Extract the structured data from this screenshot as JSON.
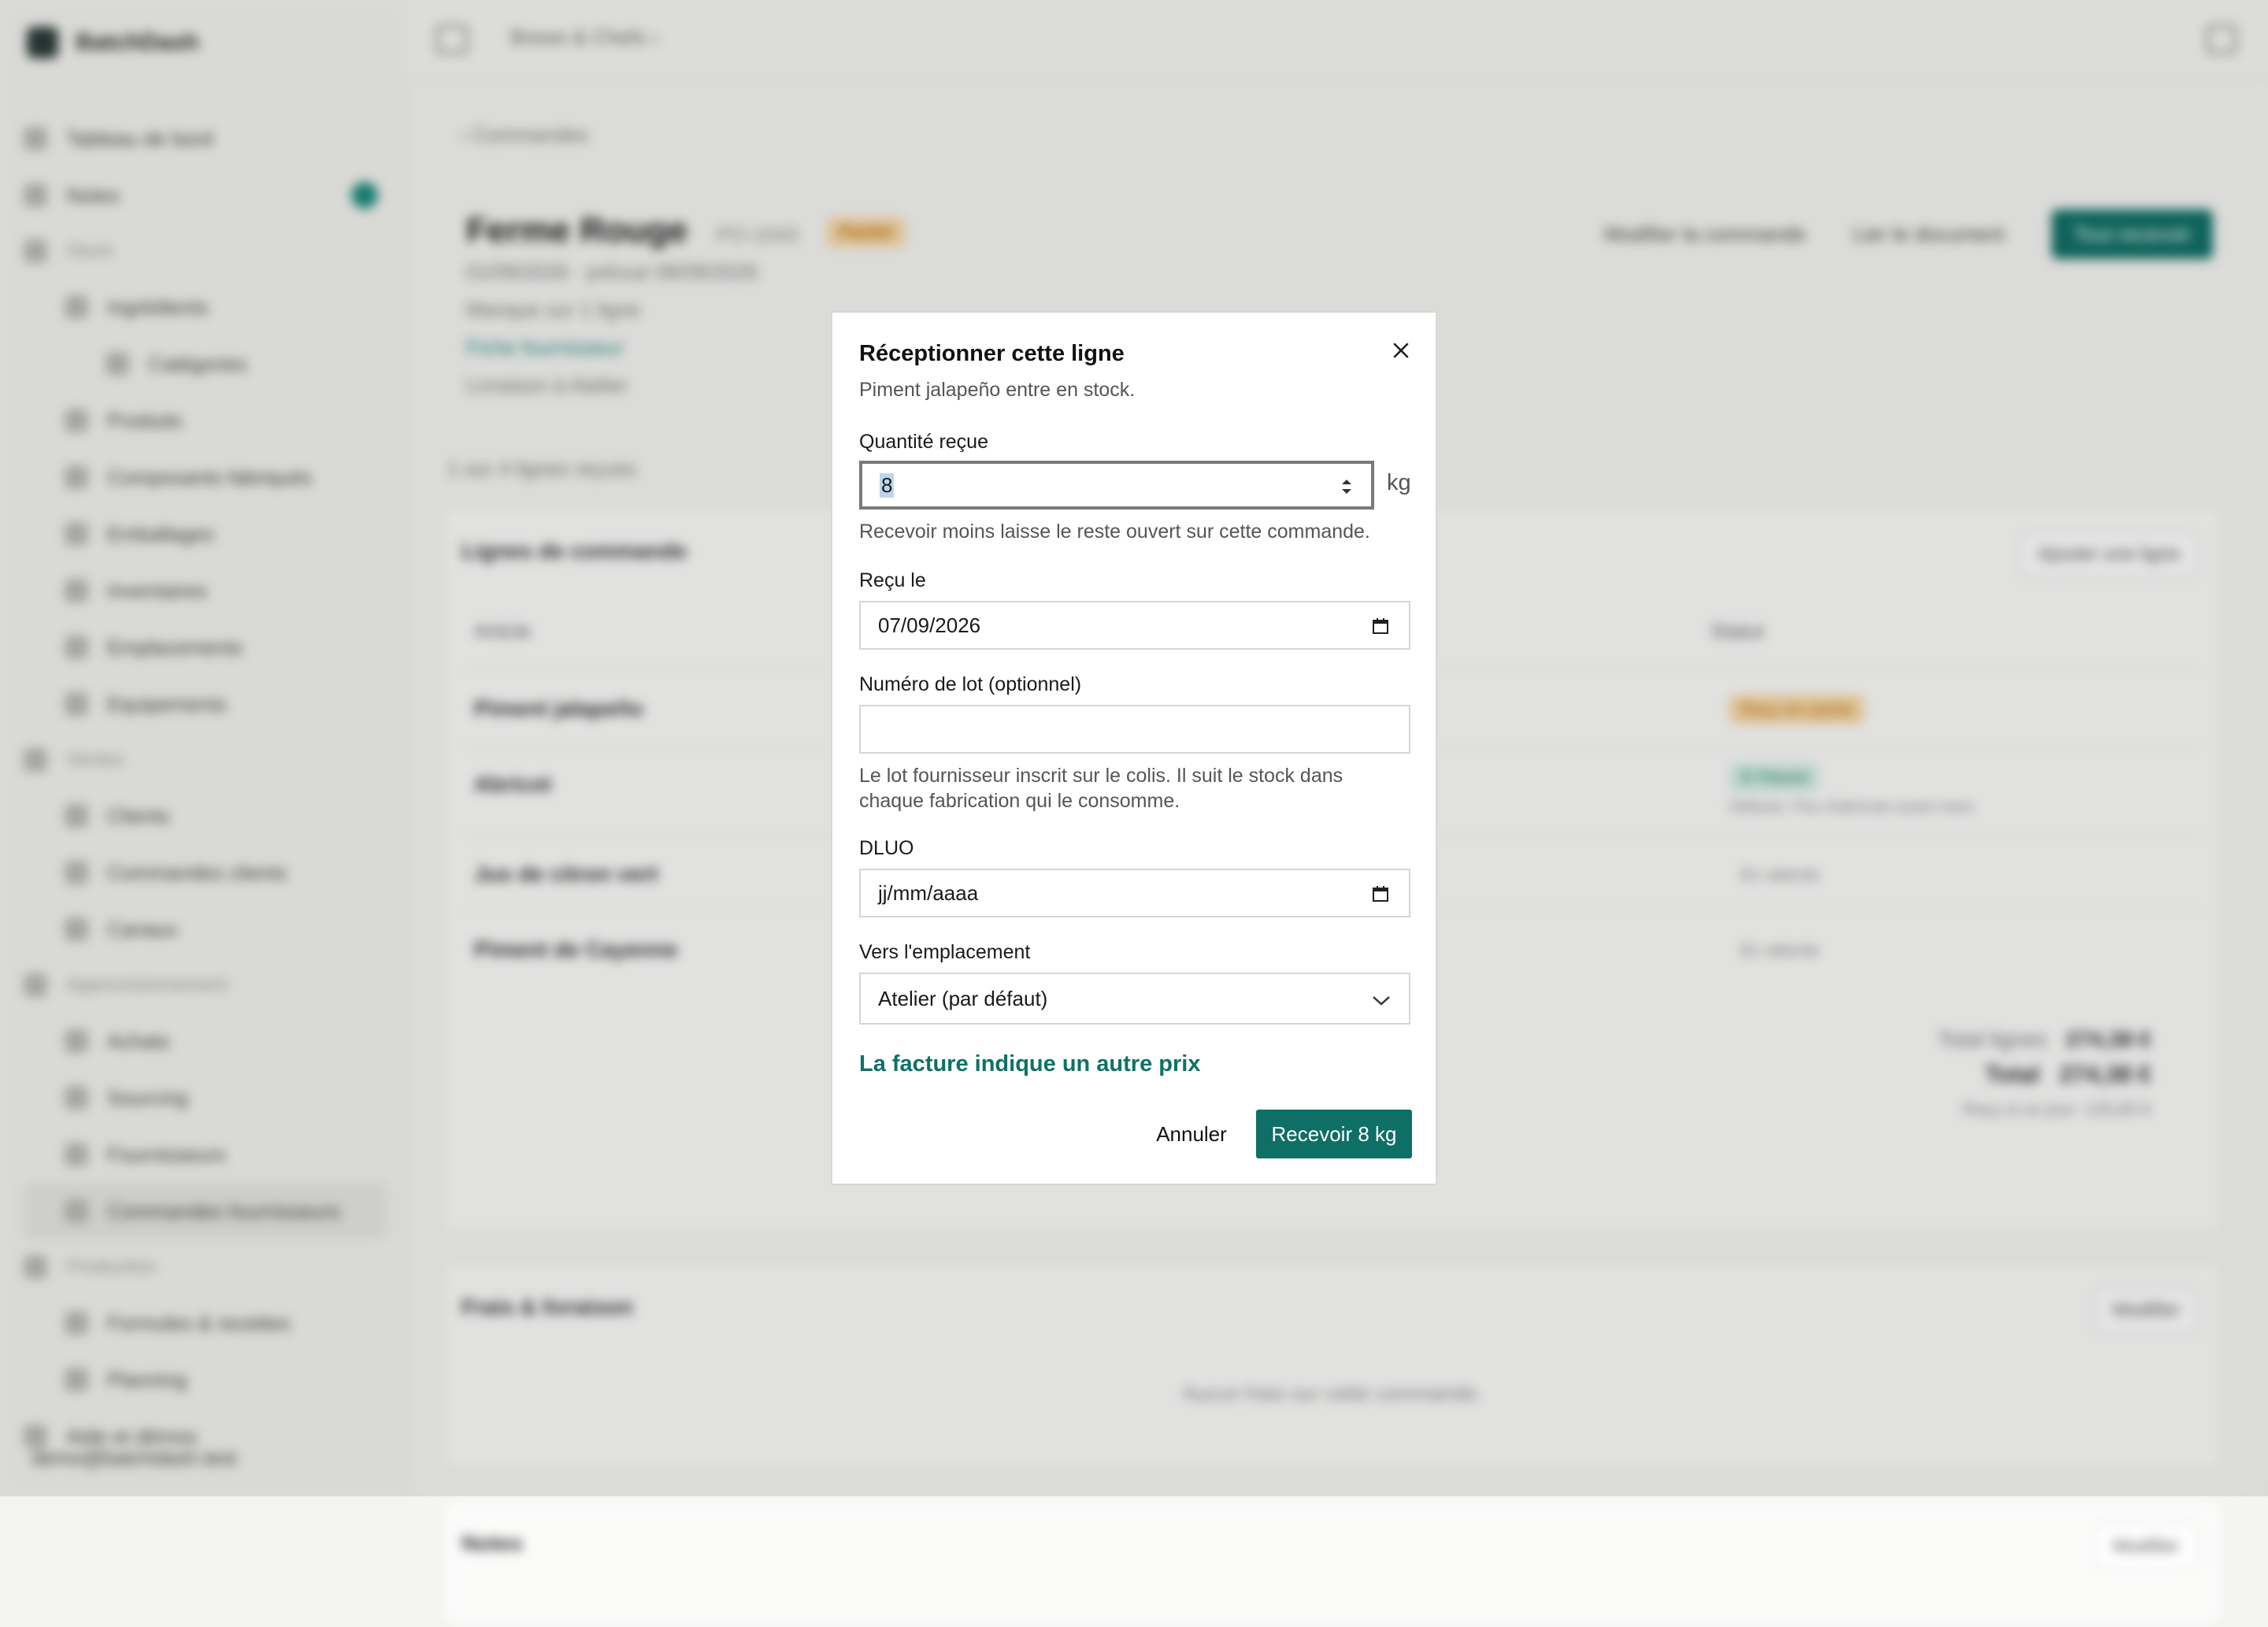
{
  "sidebar": {
    "brand": "BatchDash",
    "brand_accent": "Dash",
    "items": [
      {
        "label": "Tableau de bord",
        "level": 0
      },
      {
        "label": "Notes",
        "level": 0
      },
      {
        "label": "Stock",
        "level": "group"
      },
      {
        "label": "Ingrédients",
        "level": 1
      },
      {
        "label": "Catégories",
        "level": 2
      },
      {
        "label": "Produits",
        "level": 1
      },
      {
        "label": "Composants fabriqués",
        "level": 1
      },
      {
        "label": "Emballages",
        "level": 1
      },
      {
        "label": "Inventaires",
        "level": 1
      },
      {
        "label": "Emplacements",
        "level": 1
      },
      {
        "label": "Equipements",
        "level": 1
      },
      {
        "label": "Ventes",
        "level": "group"
      },
      {
        "label": "Clients",
        "level": 1
      },
      {
        "label": "Commandes clients",
        "level": 1
      },
      {
        "label": "Canaux",
        "level": 1
      },
      {
        "label": "Approvisionnement",
        "level": "group"
      },
      {
        "label": "Achats",
        "level": 1
      },
      {
        "label": "Sourcing",
        "level": 1
      },
      {
        "label": "Fournisseurs",
        "level": 1
      },
      {
        "label": "Commandes fournisseurs",
        "level": 1,
        "active": true
      },
      {
        "label": "Production",
        "level": "group"
      },
      {
        "label": "Formules & recettes",
        "level": 1
      },
      {
        "label": "Planning",
        "level": 1
      },
      {
        "label": "Aide et démos",
        "level": 0
      }
    ],
    "user_email": "demo@batchdash.test"
  },
  "topbar": {
    "breadcrumb": "Brews & Chefs ›"
  },
  "page": {
    "back_label": "‹ Commandes",
    "title": "Ferme Rouge",
    "po_number": "PO-1043",
    "status": "Partiel",
    "date_line": "01/09/2026 · prévue 08/09/2026",
    "missing_line": "Manque sur 1 ligne",
    "supplier_link": "Fiche fournisseur",
    "delivery_line": "Livraison à Atelier",
    "received_summary": "1 sur 4 lignes reçues",
    "actions": {
      "edit": "Modifier la commande",
      "link_doc": "Lier le document",
      "receive_all": "Tout recevoir"
    },
    "lines_card": {
      "title": "Lignes de commande",
      "add_button": "Ajouter une ligne",
      "col_article": "Article",
      "col_status": "Statut",
      "rows": [
        {
          "name": "Piment jalapeño",
          "status": "Reçu en partie"
        },
        {
          "name": "Abricot",
          "status": "À l'heure",
          "note": "Défauts: Peu d'abricots avant mars"
        },
        {
          "name": "Jus de citron vert",
          "status": "En attente"
        },
        {
          "name": "Piment de Cayenne",
          "status": "En attente"
        }
      ],
      "total_lines_label": "Total lignes",
      "total_lines_value": "274,38 €",
      "total_label": "Total",
      "total_value": "274,38 €",
      "received_label": "Reçu à ce jour: 135,60 €"
    },
    "fees_card": {
      "title": "Frais & livraison",
      "edit": "Modifier",
      "empty": "Aucun frais sur cette commande."
    },
    "notes_card": {
      "title": "Notes",
      "edit": "Modifier"
    }
  },
  "dialog": {
    "title": "Réceptionner cette ligne",
    "description": "Piment jalapeño entre en stock.",
    "qty_label": "Quantité reçue",
    "qty_value": "8",
    "qty_unit": "kg",
    "qty_help": "Recevoir moins laisse le reste ouvert sur cette commande.",
    "date_label": "Reçu le",
    "date_value": "07/09/2026",
    "lot_label": "Numéro de lot (optionnel)",
    "lot_value": "",
    "lot_help": "Le lot fournisseur inscrit sur le colis. Il suit le stock dans chaque fabrication qui le consomme.",
    "dluo_label": "DLUO",
    "dluo_placeholder": "jj/mm/aaaa",
    "location_label": "Vers l'emplacement",
    "location_value": "Atelier (par défaut)",
    "price_link": "La facture indique un autre prix",
    "cancel": "Annuler",
    "submit": "Recevoir 8 kg"
  },
  "colors": {
    "accent": "#0e6f66",
    "link": "#0e7167",
    "selection": "#bcd6ee"
  },
  "icons": [
    "close-icon",
    "spinner-icon",
    "calendar-icon",
    "chevron-down-icon",
    "sidebar-toggle-icon"
  ]
}
